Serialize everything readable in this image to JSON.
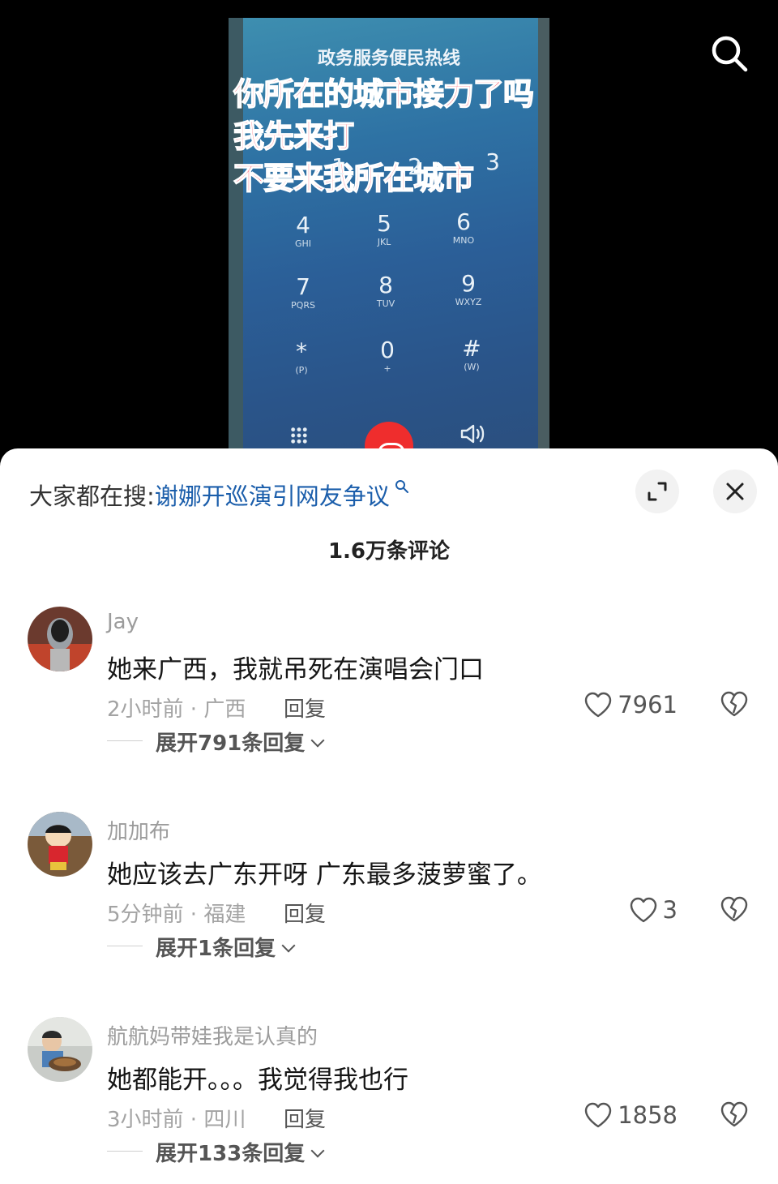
{
  "video": {
    "screen_title": "政务服务便民热线",
    "captions": [
      "你所在的城市接力了吗",
      "我先来打",
      "不要来我所在城市"
    ],
    "keys": [
      {
        "digit": "1",
        "letters": ""
      },
      {
        "digit": "2",
        "letters": ""
      },
      {
        "digit": "3",
        "letters": ""
      },
      {
        "digit": "4",
        "letters": "GHI"
      },
      {
        "digit": "5",
        "letters": "JKL"
      },
      {
        "digit": "6",
        "letters": "MNO"
      },
      {
        "digit": "7",
        "letters": "PQRS"
      },
      {
        "digit": "8",
        "letters": "TUV"
      },
      {
        "digit": "9",
        "letters": "WXYZ"
      },
      {
        "digit": "*",
        "letters": "(P)"
      },
      {
        "digit": "0",
        "letters": "+"
      },
      {
        "digit": "#",
        "letters": "(W)"
      }
    ],
    "icons": [
      "dialpad-icon",
      "end-call-icon",
      "speaker-icon",
      "search-icon"
    ]
  },
  "sheet": {
    "hot_search_label": "大家都在搜:",
    "hot_search_query": "谢娜开巡演引网友争议",
    "comment_count_title": "1.6万条评论"
  },
  "comments": [
    {
      "username": "Jay",
      "text": "她来广西，我就吊死在演唱会门口",
      "meta": "2小时前 · 广西",
      "reply_label": "回复",
      "likes": "7961",
      "expand_label": "展开791条回复"
    },
    {
      "username": "加加布",
      "text": "她应该去广东开呀  广东最多菠萝蜜了。",
      "meta": "5分钟前 · 福建",
      "reply_label": "回复",
      "likes": "3",
      "expand_label": "展开1条回复"
    },
    {
      "username": "航航妈带娃我是认真的",
      "text": "她都能开。。。我觉得我也行",
      "meta": "3小时前 · 四川",
      "reply_label": "回复",
      "likes": "1858",
      "expand_label": "展开133条回复"
    }
  ],
  "colors": {
    "link_blue": "#1b5eab",
    "caption_red": "#ff3b4e",
    "end_call_red": "#ef2d2d"
  }
}
